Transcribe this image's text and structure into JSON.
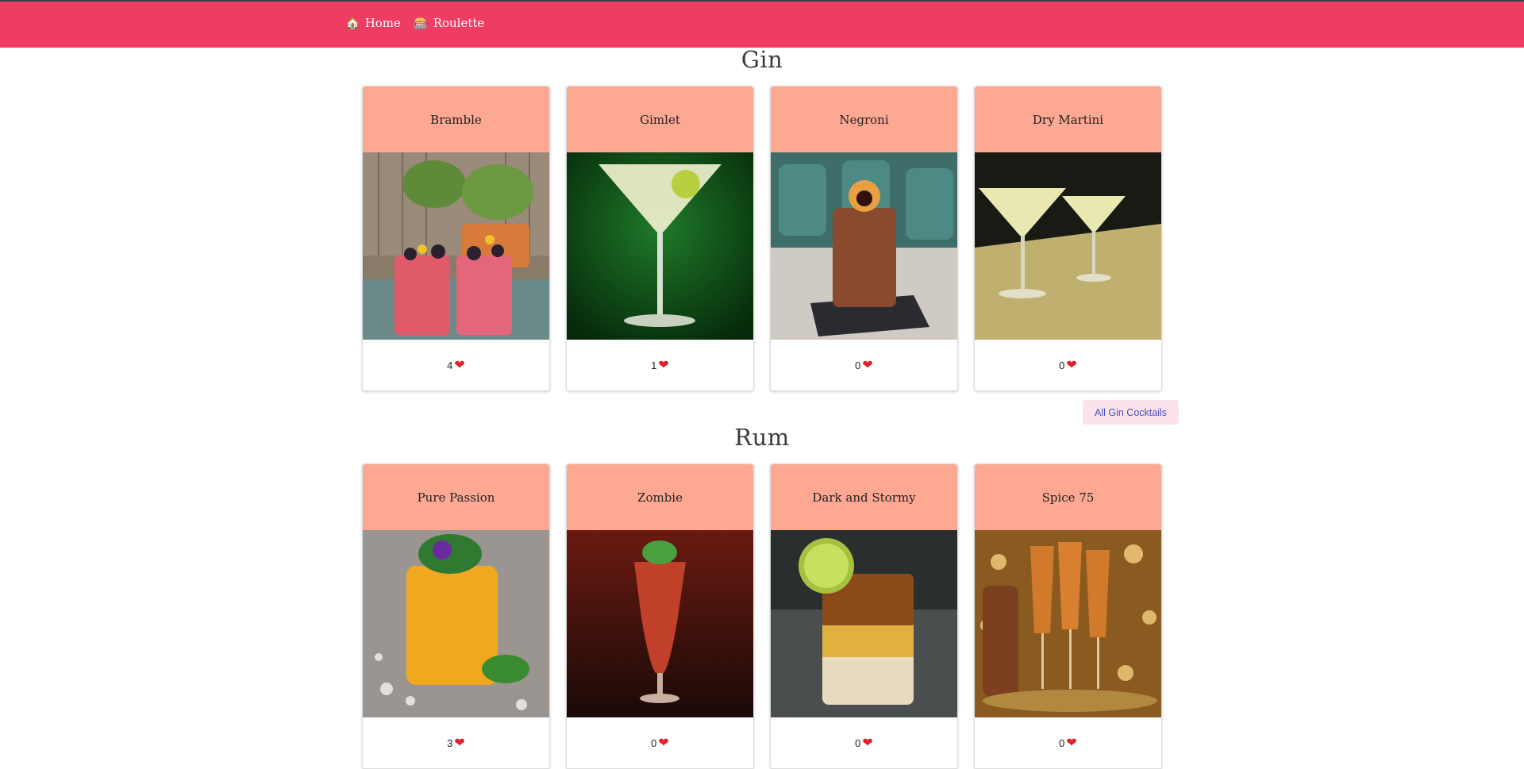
{
  "nav": {
    "home_icon": "🏠",
    "home_label": "Home",
    "roulette_icon": "🎰",
    "roulette_label": "Roulette"
  },
  "sections": [
    {
      "title": "Gin",
      "cards": [
        {
          "name": "Bramble",
          "likes": "4",
          "image": "bramble-cocktail-photo"
        },
        {
          "name": "Gimlet",
          "likes": "1",
          "image": "gimlet-cocktail-photo"
        },
        {
          "name": "Negroni",
          "likes": "0",
          "image": "negroni-cocktail-photo"
        },
        {
          "name": "Dry Martini",
          "likes": "0",
          "image": "dry-martini-cocktail-photo"
        }
      ],
      "all_button": "All Gin Cocktails"
    },
    {
      "title": "Rum",
      "cards": [
        {
          "name": "Pure Passion",
          "likes": "3",
          "image": "pure-passion-cocktail-photo"
        },
        {
          "name": "Zombie",
          "likes": "0",
          "image": "zombie-cocktail-photo"
        },
        {
          "name": "Dark and Stormy",
          "likes": "0",
          "image": "dark-and-stormy-cocktail-photo"
        },
        {
          "name": "Spice 75",
          "likes": "0",
          "image": "spice-75-cocktail-photo"
        }
      ]
    }
  ],
  "heart_icon": "❤",
  "colors": {
    "navbar": "#ee3c63",
    "card_header": "#fca892",
    "button_bg": "#fbe3ea",
    "button_text": "#4b4fc2"
  }
}
